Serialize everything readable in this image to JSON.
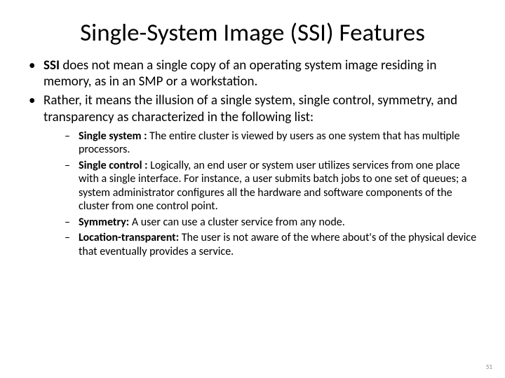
{
  "title": "Single-System Image (SSI) Features",
  "bullets": [
    {
      "bold_prefix": "SSI ",
      "text": "does not mean a single copy of an operating system image residing in memory, as in an SMP or a workstation."
    },
    {
      "text": "Rather, it means the illusion of a single system, single control, symmetry, and transparency as characterized in the following list:",
      "sub": [
        {
          "label": "Single system : ",
          "text": "The entire cluster is viewed by users as one system that has multiple processors."
        },
        {
          "label": "Single control : ",
          "text": "Logically, an end user or system user utilizes services from one place with a single interface. For instance, a user submits batch jobs to one set of queues; a system administrator configures all the hardware and software components of the cluster from one control point."
        },
        {
          "label": "Symmetry: ",
          "text": "A user can use a cluster service from any node."
        },
        {
          "label": "Location-transparent: ",
          "text": "The user is not aware of the where about's of the physical device that eventually provides a service."
        }
      ]
    }
  ],
  "page_number": "51"
}
